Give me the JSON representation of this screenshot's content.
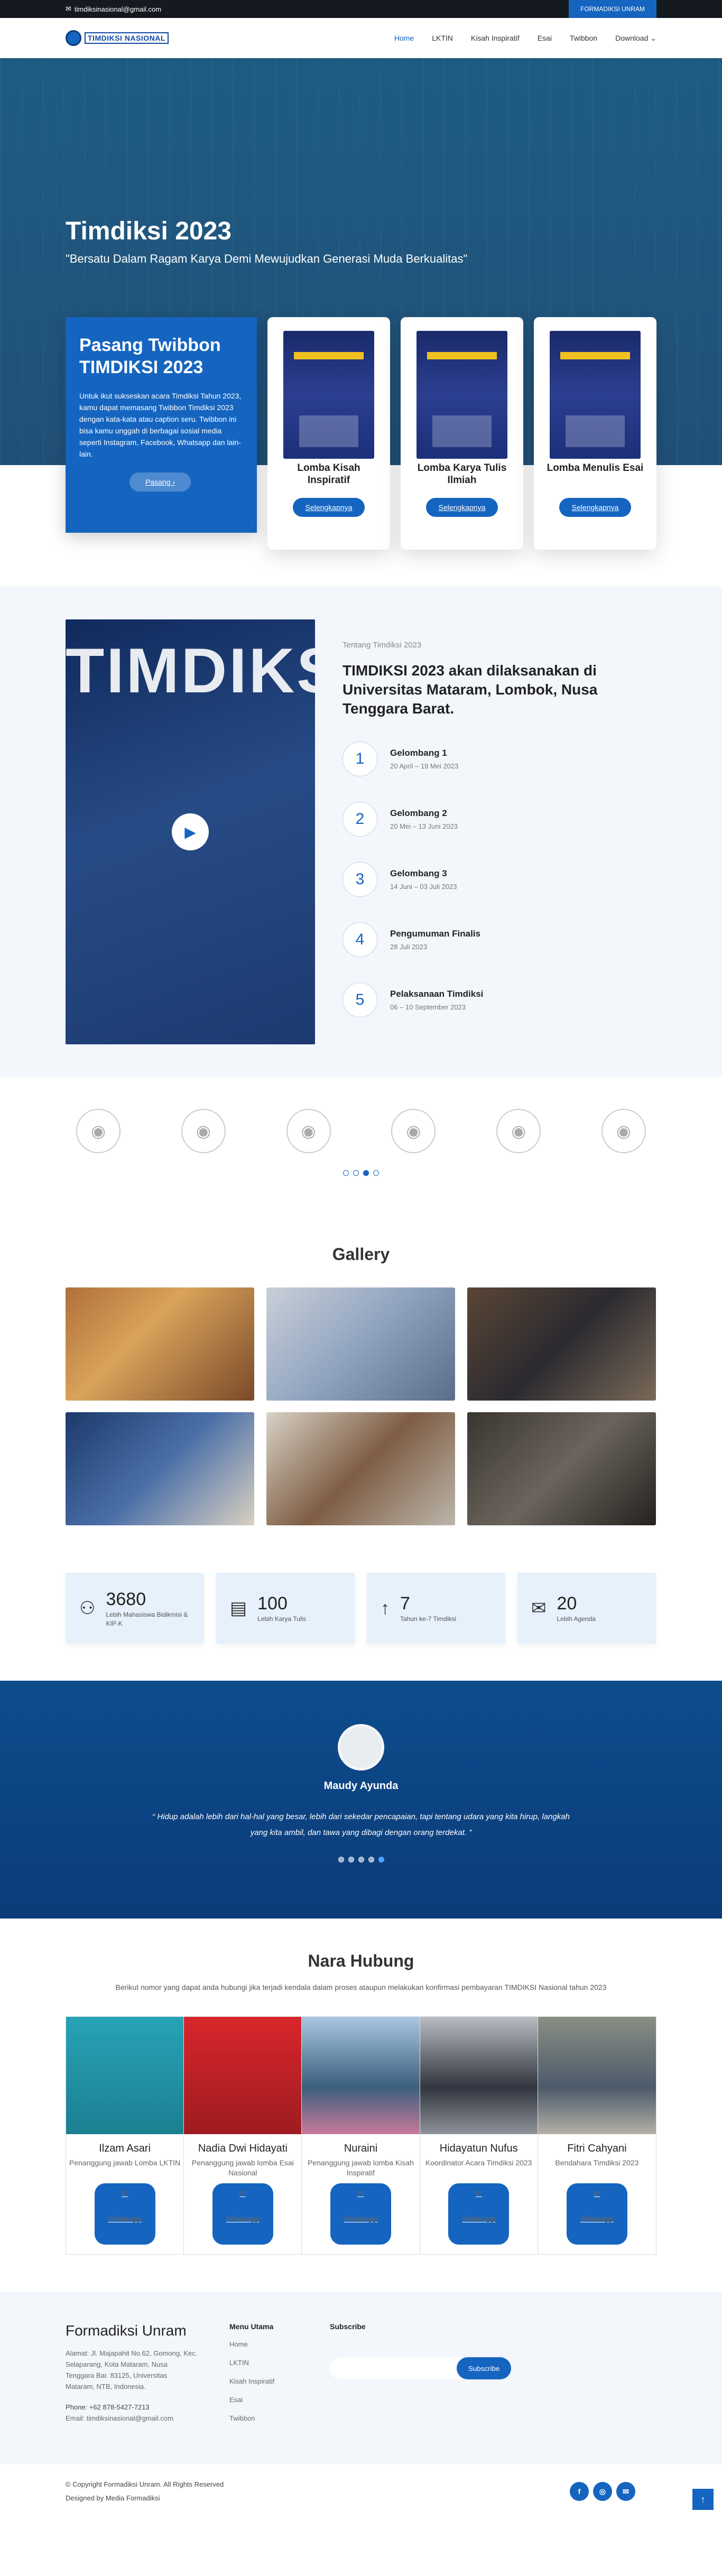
{
  "topbar": {
    "email": "timdiksinasional@gmail.com",
    "cta": "FORMADIKSI UNRAM"
  },
  "header": {
    "logo_text": "TIMDIKSI NASIONAL",
    "nav": [
      "Home",
      "LKTIN",
      "Kisah Inspiratif",
      "Esai",
      "Twibbon",
      "Download"
    ]
  },
  "hero": {
    "title": "Timdiksi 2023",
    "tagline": "\"Bersatu Dalam Ragam Karya Demi Mewujudkan Generasi Muda Berkualitas\""
  },
  "twibbon": {
    "title": "Pasang Twibbon TIMDIKSI 2023",
    "text": "Untuk ikut sukseskan acara Timdiksi Tahun 2023, kamu dapat memasang Twibbon Timdiksi 2023 dengan kata-kata atau caption seru. Twibbon ini bisa kamu unggah di berbagai sosial media seperti Instagram, Facebook, Whatsapp dan lain-lain.",
    "button": "Pasang ›"
  },
  "lomba": [
    {
      "title": "Lomba Kisah Inspiratif",
      "button": "Selengkapnya"
    },
    {
      "title": "Lomba Karya Tulis Ilmiah",
      "button": "Selengkapnya"
    },
    {
      "title": "Lomba Menulis Esai",
      "button": "Selengkapnya"
    }
  ],
  "about": {
    "video_title": "TIMDIKS",
    "subtitle": "Tentang Timdiksi 2023",
    "title": "TIMDIKSI 2023 akan dilaksanakan di Universitas Mataram, Lombok, Nusa Tenggara Barat.",
    "steps": [
      {
        "num": "1",
        "title": "Gelombang 1",
        "date": "20 April – 19 Mei 2023"
      },
      {
        "num": "2",
        "title": "Gelombang 2",
        "date": "20 Mei – 13 Juni 2023"
      },
      {
        "num": "3",
        "title": "Gelombang 3",
        "date": "14 Juni – 03 Juli 2023"
      },
      {
        "num": "4",
        "title": "Pengumuman Finalis",
        "date": "28 Juli 2023"
      },
      {
        "num": "5",
        "title": "Pelaksanaan Timdiksi",
        "date": "06 – 10 September 2023"
      }
    ]
  },
  "gallery": {
    "title": "Gallery"
  },
  "stats": [
    {
      "icon": "users-icon",
      "value": "3680",
      "label": "Lebih Mahasiswa Bidikmisi & KIP-K"
    },
    {
      "icon": "document-icon",
      "value": "100",
      "label": "Lebih Karya Tulis"
    },
    {
      "icon": "arrow-up-icon",
      "value": "7",
      "label": "Tahun ke-7 Timdiksi"
    },
    {
      "icon": "envelope-icon",
      "value": "20",
      "label": "Lebih Agenda"
    }
  ],
  "testimonial": {
    "name": "Maudy Ayunda",
    "quote": "Hidup adalah lebih dari hal-hal yang besar, lebih dari sekedar pencapaian, tapi tentang udara yang kita hirup, langkah yang kita ambil, dan tawa yang dibagi dengan orang terdekat."
  },
  "contact": {
    "title": "Nara Hubung",
    "lead": "Berikut nomor yang dapat anda hubungi jika terjadi kendala dalam proses ataupun melakukan konfirmasi pembayaran TIMDIKSI Nasional tahun 2023",
    "people": [
      {
        "name": "Ilzam Asari",
        "role": "Penanggung jawab Lomba LKTIN",
        "button": "Whatsapp"
      },
      {
        "name": "Nadia Dwi Hidayati",
        "role": "Penanggung jawab lomba Esai Nasional",
        "button": "Whatsapp"
      },
      {
        "name": "Nuraini",
        "role": "Penanggung jawab lomba Kisah Inspiratif",
        "button": "Whatsapp"
      },
      {
        "name": "Hidayatun Nufus",
        "role": "Koordinator Acara Timdiksi 2023",
        "button": "Whatsapp"
      },
      {
        "name": "Fitri Cahyani",
        "role": "Bendahara Timdiksi 2023",
        "button": "Whatsapp"
      }
    ]
  },
  "footer": {
    "title": "Formadiksi Unram",
    "address": "Alamat: Jl. Majapahit No.62, Gomong, Kec. Selaparang, Kota Mataram, Nusa Tenggara Bar. 83125, Universitas Mataram, NTB, Indonesia.",
    "phone": "Phone: +62 878-5427-7213",
    "email": "Email: timdiksinasional@gmail.com",
    "menu_title": "Menu Utama",
    "menu": [
      "Home",
      "LKTIN",
      "Kisah Inspiratif",
      "Esai",
      "Twibbon"
    ],
    "subscribe_title": "Subscribe",
    "subscribe_btn": "Subscribe",
    "copyright": "© Copyright Formadiksi Unram. All Rights Reserved",
    "designed": "Designed by Media Formadiksi"
  }
}
